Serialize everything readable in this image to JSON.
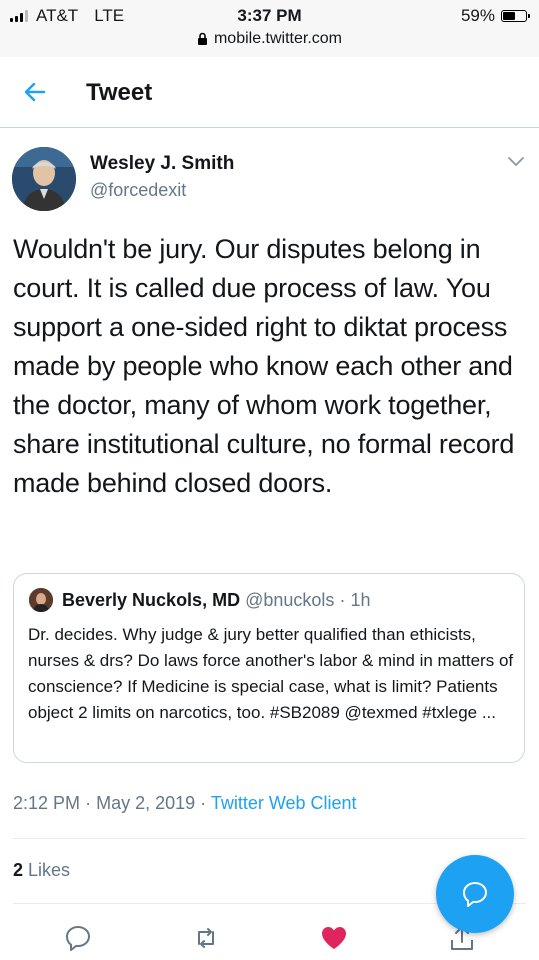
{
  "status_bar": {
    "carrier": "AT&T",
    "network": "LTE",
    "time": "3:37 PM",
    "battery_percent": "59%",
    "battery_level": 0.59,
    "url": "mobile.twitter.com"
  },
  "header": {
    "title": "Tweet",
    "back_icon": "arrow-left-icon"
  },
  "tweet": {
    "author_name": "Wesley J. Smith",
    "author_handle": "@forcedexit",
    "text": "Wouldn't be jury. Our disputes belong in court. It is called due process of law. You support a one-sided right to diktat process made by people who know each other and the doctor, many of whom work together, share institutional culture, no formal record made behind closed doors.",
    "time": "2:12 PM",
    "separator": "·",
    "date": "May 2, 2019",
    "client": "Twitter Web Client",
    "likes_count": "2",
    "likes_label": "Likes"
  },
  "quoted_tweet": {
    "author_name": "Beverly Nuckols, MD",
    "author_handle": "@bnuckols",
    "separator": "·",
    "age": "1h",
    "text": "Dr. decides. Why judge & jury better qualified than ethicists, nurses & drs? Do laws force another's labor & mind in matters of conscience? If Medicine is special case, what is limit? Patients object 2 limits on narcotics, too.  #SB2089 @texmed #txlege ..."
  },
  "actions": [
    "reply-icon",
    "retweet-icon",
    "heart-icon",
    "share-icon"
  ],
  "colors": {
    "accent": "#1da1f2",
    "like": "#e0245e",
    "secondary_text": "#657786"
  }
}
